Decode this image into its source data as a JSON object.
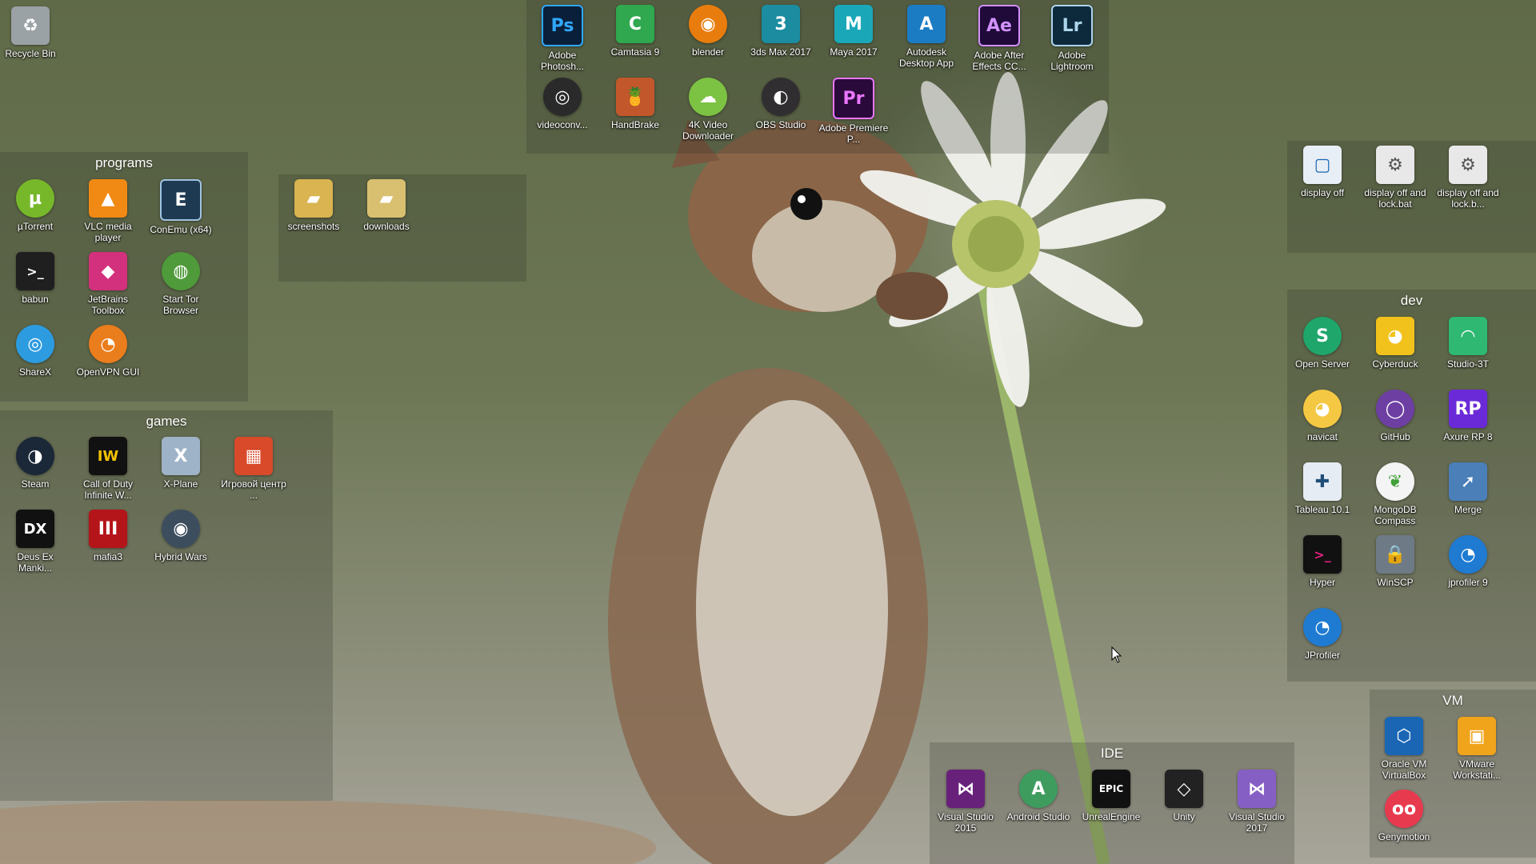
{
  "desktop": {
    "loose_icons": [
      {
        "label": "Recycle Bin",
        "icon": "recycle-bin-icon",
        "color": "#9aa2a6",
        "glyph": "♻"
      },
      {
        "label": "Adobe Photosh...",
        "icon": "photoshop-icon",
        "color": "#0a1f3a",
        "glyph": "Ps"
      },
      {
        "label": "Camtasia 9",
        "icon": "camtasia-icon",
        "color": "#2fa84f",
        "glyph": "C"
      },
      {
        "label": "blender",
        "icon": "blender-icon",
        "color": "#e87d0d",
        "glyph": "◉"
      },
      {
        "label": "3ds Max 2017",
        "icon": "3dsmax-icon",
        "color": "#1c8ca0",
        "glyph": "3"
      },
      {
        "label": "Maya 2017",
        "icon": "maya-icon",
        "color": "#1aa8b8",
        "glyph": "M"
      },
      {
        "label": "Autodesk Desktop App",
        "icon": "autodesk-icon",
        "color": "#1b7cc4",
        "glyph": "A"
      },
      {
        "label": "Adobe After Effects CC...",
        "icon": "after-effects-icon",
        "color": "#1f0a3a",
        "glyph": "Ae"
      },
      {
        "label": "Adobe Lightroom",
        "icon": "lightroom-icon",
        "color": "#0d2a3d",
        "glyph": "Lr"
      },
      {
        "label": "videoconv...",
        "icon": "videoconverter-icon",
        "color": "#2a2a2a",
        "glyph": "◎"
      },
      {
        "label": "HandBrake",
        "icon": "handbrake-icon",
        "color": "#c2572c",
        "glyph": "🍍"
      },
      {
        "label": "4K Video Downloader",
        "icon": "4k-downloader-icon",
        "color": "#7cc243",
        "glyph": "☁"
      },
      {
        "label": "OBS Studio",
        "icon": "obs-icon",
        "color": "#302e31",
        "glyph": "◐"
      },
      {
        "label": "Adobe Premiere P...",
        "icon": "premiere-icon",
        "color": "#2a0a3a",
        "glyph": "Pr"
      }
    ],
    "fences": {
      "programs": {
        "title": "programs",
        "items": [
          {
            "label": "µTorrent",
            "icon": "utorrent-icon",
            "color": "#77b82a",
            "glyph": "µ"
          },
          {
            "label": "VLC media player",
            "icon": "vlc-icon",
            "color": "#f08a14",
            "glyph": "▲"
          },
          {
            "label": "ConEmu (x64)",
            "icon": "conemu-icon",
            "color": "#1e3a52",
            "glyph": "E"
          },
          {
            "label": "babun",
            "icon": "babun-icon",
            "color": "#1f1f1f",
            "glyph": ">_"
          },
          {
            "label": "JetBrains Toolbox",
            "icon": "jetbrains-toolbox-icon",
            "color": "#d3307d",
            "glyph": "◆"
          },
          {
            "label": "Start Tor Browser",
            "icon": "tor-browser-icon",
            "color": "#4f9a3a",
            "glyph": "◍"
          },
          {
            "label": "ShareX",
            "icon": "sharex-icon",
            "color": "#2d9be0",
            "glyph": "◎"
          },
          {
            "label": "OpenVPN GUI",
            "icon": "openvpn-icon",
            "color": "#ea7d1c",
            "glyph": "◔"
          }
        ]
      },
      "shortcuts": {
        "items": [
          {
            "label": "screenshots",
            "icon": "folder-icon",
            "color": "#d9b450",
            "glyph": "▰"
          },
          {
            "label": "downloads",
            "icon": "folder-icon",
            "color": "#d9c070",
            "glyph": "▰"
          }
        ]
      },
      "games": {
        "title": "games",
        "items": [
          {
            "label": "Steam",
            "icon": "steam-icon",
            "color": "#1b2838",
            "glyph": "◑"
          },
          {
            "label": "Call of Duty Infinite W...",
            "icon": "cod-icon",
            "color": "#111111",
            "glyph": "IW"
          },
          {
            "label": "X-Plane",
            "icon": "xplane-icon",
            "color": "#9fb3c8",
            "glyph": "X"
          },
          {
            "label": "Игровой центр ...",
            "icon": "game-center-icon",
            "color": "#d84a2a",
            "glyph": "▦"
          },
          {
            "label": "Deus Ex Manki...",
            "icon": "deus-ex-icon",
            "color": "#111111",
            "glyph": "DX"
          },
          {
            "label": "mafia3",
            "icon": "mafia3-icon",
            "color": "#b3151a",
            "glyph": "III"
          },
          {
            "label": "Hybrid Wars",
            "icon": "hybrid-wars-icon",
            "color": "#3c4d5e",
            "glyph": "◉"
          }
        ]
      },
      "display": {
        "items": [
          {
            "label": "display off",
            "icon": "display-off-icon",
            "color": "#e8eef5",
            "glyph": "▢"
          },
          {
            "label": "display off and lock.bat",
            "icon": "bat-file-icon",
            "color": "#e8e8e8",
            "glyph": "⚙"
          },
          {
            "label": "display off and lock.b...",
            "icon": "bat-file-icon",
            "color": "#e8e8e8",
            "glyph": "⚙"
          }
        ]
      },
      "dev": {
        "title": "dev",
        "items": [
          {
            "label": "Open Server",
            "icon": "open-server-icon",
            "color": "#1fa66a",
            "glyph": "S"
          },
          {
            "label": "Cyberduck",
            "icon": "cyberduck-icon",
            "color": "#f1c21b",
            "glyph": "◕"
          },
          {
            "label": "Studio-3T",
            "icon": "studio3t-icon",
            "color": "#2eb872",
            "glyph": "◠"
          },
          {
            "label": "navicat",
            "icon": "navicat-icon",
            "color": "#f4c842",
            "glyph": "◕"
          },
          {
            "label": "GitHub",
            "icon": "github-icon",
            "color": "#6e3fa3",
            "glyph": "◯"
          },
          {
            "label": "Axure RP 8",
            "icon": "axure-icon",
            "color": "#6b2ad8",
            "glyph": "RP"
          },
          {
            "label": "Tableau 10.1",
            "icon": "tableau-icon",
            "color": "#e6ecf3",
            "glyph": "✚"
          },
          {
            "label": "MongoDB Compass",
            "icon": "mongodb-icon",
            "color": "#f4f4f4",
            "glyph": "❦"
          },
          {
            "label": "Merge",
            "icon": "merge-icon",
            "color": "#4a7fb8",
            "glyph": "➚"
          },
          {
            "label": "Hyper",
            "icon": "hyper-icon",
            "color": "#111111",
            "glyph": ">_"
          },
          {
            "label": "WinSCP",
            "icon": "winscp-icon",
            "color": "#6e7a86",
            "glyph": "🔒"
          },
          {
            "label": "jprofiler 9",
            "icon": "jprofiler-icon",
            "color": "#1f7bd1",
            "glyph": "◔"
          },
          {
            "label": "JProfiler",
            "icon": "jprofiler-icon",
            "color": "#1f7bd1",
            "glyph": "◔"
          }
        ]
      },
      "vm": {
        "title": "VM",
        "items": [
          {
            "label": "Oracle VM VirtualBox",
            "icon": "virtualbox-icon",
            "color": "#1a66b5",
            "glyph": "⬡"
          },
          {
            "label": "VMware Workstati...",
            "icon": "vmware-icon",
            "color": "#f0a41c",
            "glyph": "▣"
          },
          {
            "label": "Genymotion",
            "icon": "genymotion-icon",
            "color": "#e83a4f",
            "glyph": "oo"
          }
        ]
      },
      "ide": {
        "title": "IDE",
        "items": [
          {
            "label": "Visual Studio 2015",
            "icon": "visual-studio-icon",
            "color": "#68217a",
            "glyph": "⋈"
          },
          {
            "label": "Android Studio",
            "icon": "android-studio-icon",
            "color": "#3f9c5f",
            "glyph": "A"
          },
          {
            "label": "UnrealEngine",
            "icon": "unreal-engine-icon",
            "color": "#111111",
            "glyph": "EPIC"
          },
          {
            "label": "Unity",
            "icon": "unity-icon",
            "color": "#222222",
            "glyph": "◇"
          },
          {
            "label": "Visual Studio 2017",
            "icon": "visual-studio-icon",
            "color": "#865fc5",
            "glyph": "⋈"
          }
        ]
      }
    }
  }
}
